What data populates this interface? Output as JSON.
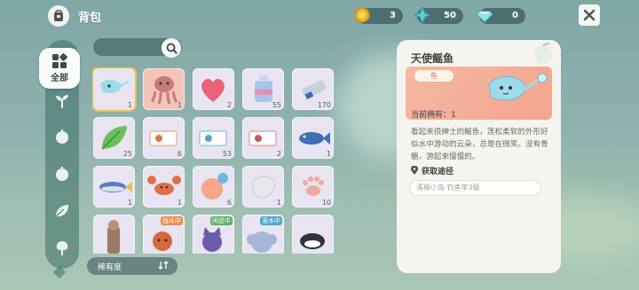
{
  "header": {
    "title": "背包"
  },
  "currencies": [
    {
      "icon": "gold-coin-icon",
      "value": "3"
    },
    {
      "icon": "star-crystal-icon",
      "value": "50"
    },
    {
      "icon": "diamond-icon",
      "value": "0"
    }
  ],
  "sidebar": {
    "active_label": "全部",
    "categories": [
      "grid-icon",
      "sprout-icon",
      "apple-icon",
      "apple-icon",
      "leaf-icon",
      "tree-icon"
    ]
  },
  "search": {
    "placeholder": ""
  },
  "sort": {
    "label": "稀有度"
  },
  "items": [
    {
      "name": "stingray",
      "count": "1",
      "selected": true
    },
    {
      "name": "octopus",
      "count": "1"
    },
    {
      "name": "heart-jelly",
      "count": "2"
    },
    {
      "name": "bottle",
      "count": "55"
    },
    {
      "name": "spray",
      "count": "170"
    },
    {
      "name": "green-leaf",
      "count": "25"
    },
    {
      "name": "ticket",
      "count": "6"
    },
    {
      "name": "blue-ticket",
      "count": "53"
    },
    {
      "name": "ticket-2",
      "count": "2"
    },
    {
      "name": "blue-fish",
      "count": "1"
    },
    {
      "name": "tuna",
      "count": "1"
    },
    {
      "name": "crab",
      "count": "1"
    },
    {
      "name": "peach",
      "count": "6"
    },
    {
      "name": "clear-gem",
      "count": "1"
    },
    {
      "name": "paw",
      "count": "10"
    },
    {
      "name": "tower",
      "count": ""
    },
    {
      "name": "red-panda",
      "count": "",
      "tag": "战斗中"
    },
    {
      "name": "purple-cat",
      "count": "",
      "tag": "闲逛中"
    },
    {
      "name": "elephant",
      "count": "",
      "tag": "滚水中"
    },
    {
      "name": "orca",
      "count": ""
    }
  ],
  "detail": {
    "title": "天使鳐鱼",
    "category": "鱼",
    "owned": "当前拥有：1",
    "description": "看起来很绅士的鳐鱼，莲松柔软的外形好似水中游动的云朵，总是在微笑。没有骨骼，游起来慢慢的。",
    "source_heading": "获取途径",
    "source": "溪柳小岛 钓鱼竿3级"
  }
}
